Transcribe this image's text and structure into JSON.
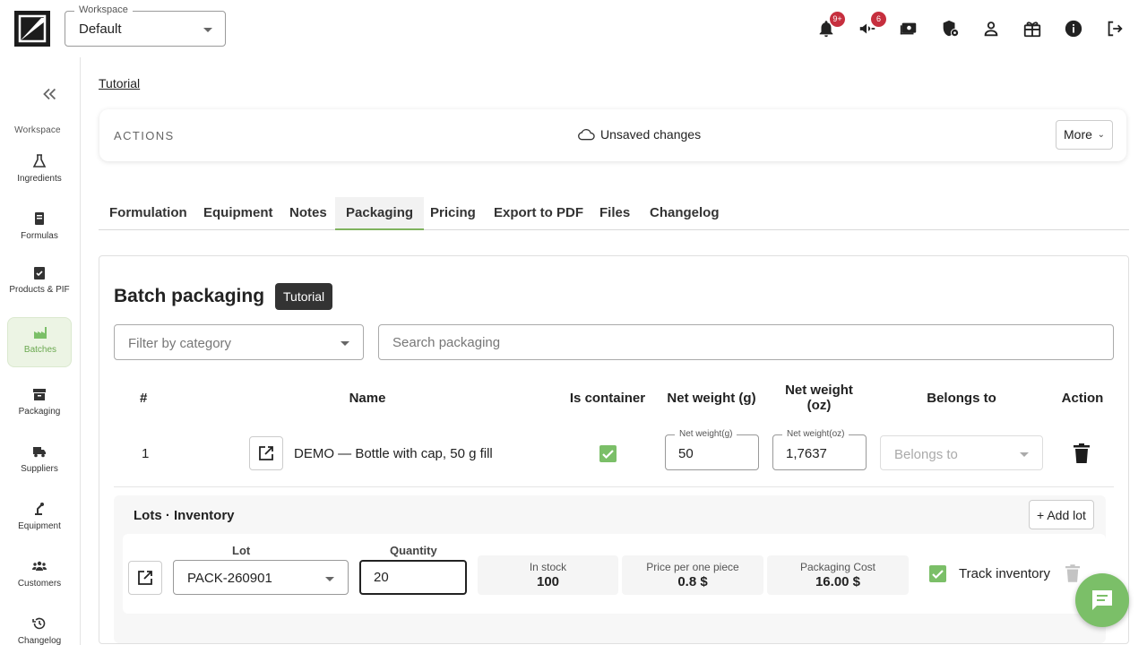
{
  "header": {
    "workspace_label": "Workspace",
    "workspace_value": "Default",
    "notifications_badge": "9+",
    "announcements_badge": "6",
    "icons": [
      "bell-icon",
      "megaphone-icon",
      "billing-icon",
      "security-icon",
      "account-icon",
      "gift-icon",
      "info-icon",
      "logout-icon"
    ]
  },
  "sidebar": {
    "section": "Workspace",
    "items": [
      {
        "label": "Ingredients",
        "icon": "flask-icon"
      },
      {
        "label": "Formulas",
        "icon": "book-icon"
      },
      {
        "label": "Products & PIF",
        "icon": "clipboard-check-icon"
      },
      {
        "label": "Batches",
        "icon": "factory-icon",
        "active": true
      },
      {
        "label": "Packaging",
        "icon": "archive-box-icon"
      },
      {
        "label": "Suppliers",
        "icon": "truck-icon"
      },
      {
        "label": "Equipment",
        "icon": "robot-arm-icon"
      },
      {
        "label": "Customers",
        "icon": "people-icon"
      },
      {
        "label": "Changelog",
        "icon": "history-icon"
      }
    ]
  },
  "breadcrumb": "Tutorial",
  "actions": {
    "title": "ACTIONS",
    "status": "Unsaved changes",
    "more": "More"
  },
  "tabs": [
    "Formulation",
    "Equipment",
    "Notes",
    "Packaging",
    "Pricing",
    "Export to PDF",
    "Files",
    "Changelog"
  ],
  "active_tab": "Packaging",
  "packaging": {
    "title": "Batch packaging",
    "tooltip": "Tutorial",
    "filter_placeholder": "Filter by category",
    "search_placeholder": "Search packaging",
    "columns": {
      "num": "#",
      "name": "Name",
      "is_container": "Is container",
      "net_weight_g": "Net weight (g)",
      "net_weight_oz": "Net weight (oz)",
      "belongs_to": "Belongs to",
      "action": "Action"
    },
    "row": {
      "num": "1",
      "name": "DEMO — Bottle with cap, 50 g fill",
      "is_container": true,
      "net_weight_g_label": "Net weight(g)",
      "net_weight_g": "50",
      "net_weight_oz_label": "Net weight(oz)",
      "net_weight_oz": "1,7637",
      "belongs_to_placeholder": "Belongs to"
    }
  },
  "lots": {
    "title": "Lots · Inventory",
    "add_lot": "+ Add lot",
    "lot_label": "Lot",
    "lot_value": "PACK-260901",
    "quantity_label": "Quantity",
    "quantity_value": "20",
    "in_stock_label": "In stock",
    "in_stock_value": "100",
    "price_label": "Price per one piece",
    "price_value": "0.8 $",
    "cost_label": "Packaging Cost",
    "cost_value": "16.00 $",
    "track_inventory_label": "Track inventory",
    "track_inventory": true
  },
  "colors": {
    "accent_green": "#7bbf68",
    "badge_red": "#c62f3e",
    "dark": "#1c1c1c"
  }
}
